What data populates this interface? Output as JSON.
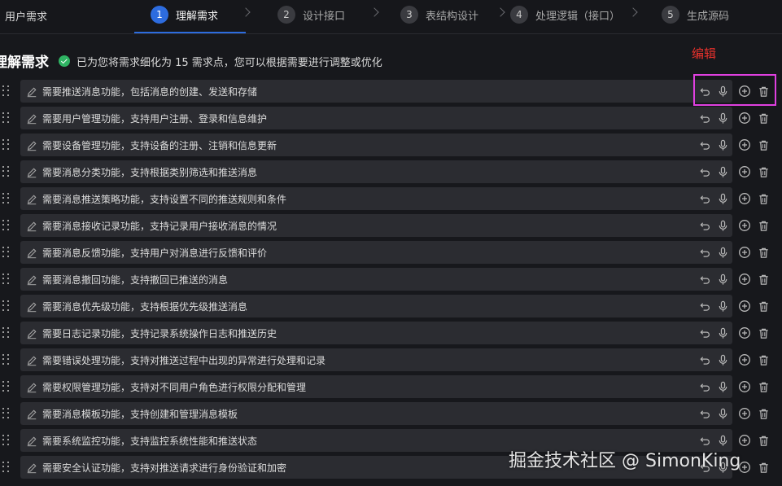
{
  "app": {
    "title": "用户需求"
  },
  "steps": [
    {
      "num": "1",
      "label": "理解需求"
    },
    {
      "num": "2",
      "label": "设计接口"
    },
    {
      "num": "3",
      "label": "表结构设计"
    },
    {
      "num": "4",
      "label": "处理逻辑（接口）"
    },
    {
      "num": "5",
      "label": "生成源码"
    }
  ],
  "active_step": 1,
  "section": {
    "title": "理解需求",
    "info": "已为您将需求细化为 15 需求点，您可以根据需要进行调整或优化"
  },
  "annotation": {
    "label": "编辑",
    "color": "#e8312c",
    "box_color": "#e040e0"
  },
  "requirements": [
    "需要推送消息功能，包括消息的创建、发送和存储",
    "需要用户管理功能，支持用户注册、登录和信息维护",
    "需要设备管理功能，支持设备的注册、注销和信息更新",
    "需要消息分类功能，支持根据类别筛选和推送消息",
    "需要消息推送策略功能，支持设置不同的推送规则和条件",
    "需要消息接收记录功能，支持记录用户接收消息的情况",
    "需要消息反馈功能，支持用户对消息进行反馈和评价",
    "需要消息撤回功能，支持撤回已推送的消息",
    "需要消息优先级功能，支持根据优先级推送消息",
    "需要日志记录功能，支持记录系统操作日志和推送历史",
    "需要错误处理功能，支持对推送过程中出现的异常进行处理和记录",
    "需要权限管理功能，支持对不同用户角色进行权限分配和管理",
    "需要消息模板功能，支持创建和管理消息模板",
    "需要系统监控功能，支持监控系统性能和推送状态",
    "需要安全认证功能，支持对推送请求进行身份验证和加密"
  ],
  "row_icons": [
    "drag-handle-icon",
    "edit-pencil-icon",
    "undo-icon",
    "microphone-icon",
    "add-circle-icon",
    "delete-trash-icon"
  ],
  "colors": {
    "accent": "#2d6cdf",
    "success": "#2fb463",
    "background": "#17181c",
    "row": "#2b2c31"
  },
  "watermark": "掘金技术社区 @ SimonKing"
}
